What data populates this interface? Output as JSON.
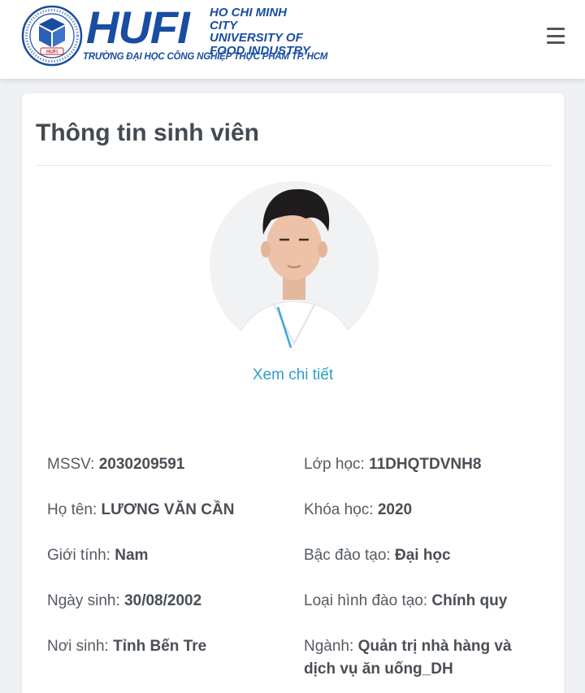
{
  "header": {
    "logo_main": "HUFI",
    "logo_city_lines": [
      "HO CHI MINH CITY",
      "UNIVERSITY OF",
      "FOOD INDUSTRY"
    ],
    "logo_vietnamese": "TRƯỜNG ĐẠI HỌC CÔNG NGHIỆP THỰC PHẨM TP. HCM",
    "seal_badge": "HUFI",
    "brand_color": "#1a4da1",
    "menu_icon": "hamburger-menu-icon"
  },
  "card": {
    "title": "Thông tin sinh viên",
    "detail_link": "Xem chi tiết",
    "link_color": "#2f9fc9"
  },
  "student": {
    "left": [
      {
        "label": "MSSV:",
        "value": "2030209591"
      },
      {
        "label": "Họ tên:",
        "value": "LƯƠNG VĂN CẦN"
      },
      {
        "label": "Giới tính:",
        "value": "Nam"
      },
      {
        "label": "Ngày sinh:",
        "value": "30/08/2002"
      },
      {
        "label": "Nơi sinh:",
        "value": "Tỉnh Bến Tre"
      }
    ],
    "right": [
      {
        "label": "Lớp học:",
        "value": "11DHQTDVNH8"
      },
      {
        "label": "Khóa học:",
        "value": "2020"
      },
      {
        "label": "Bậc đào tạo:",
        "value": "Đại học"
      },
      {
        "label": "Loại hình đào tạo:",
        "value": "Chính quy"
      },
      {
        "label": "Ngành:",
        "value": "Quản trị nhà hàng và dịch vụ ăn uống_DH"
      }
    ]
  }
}
